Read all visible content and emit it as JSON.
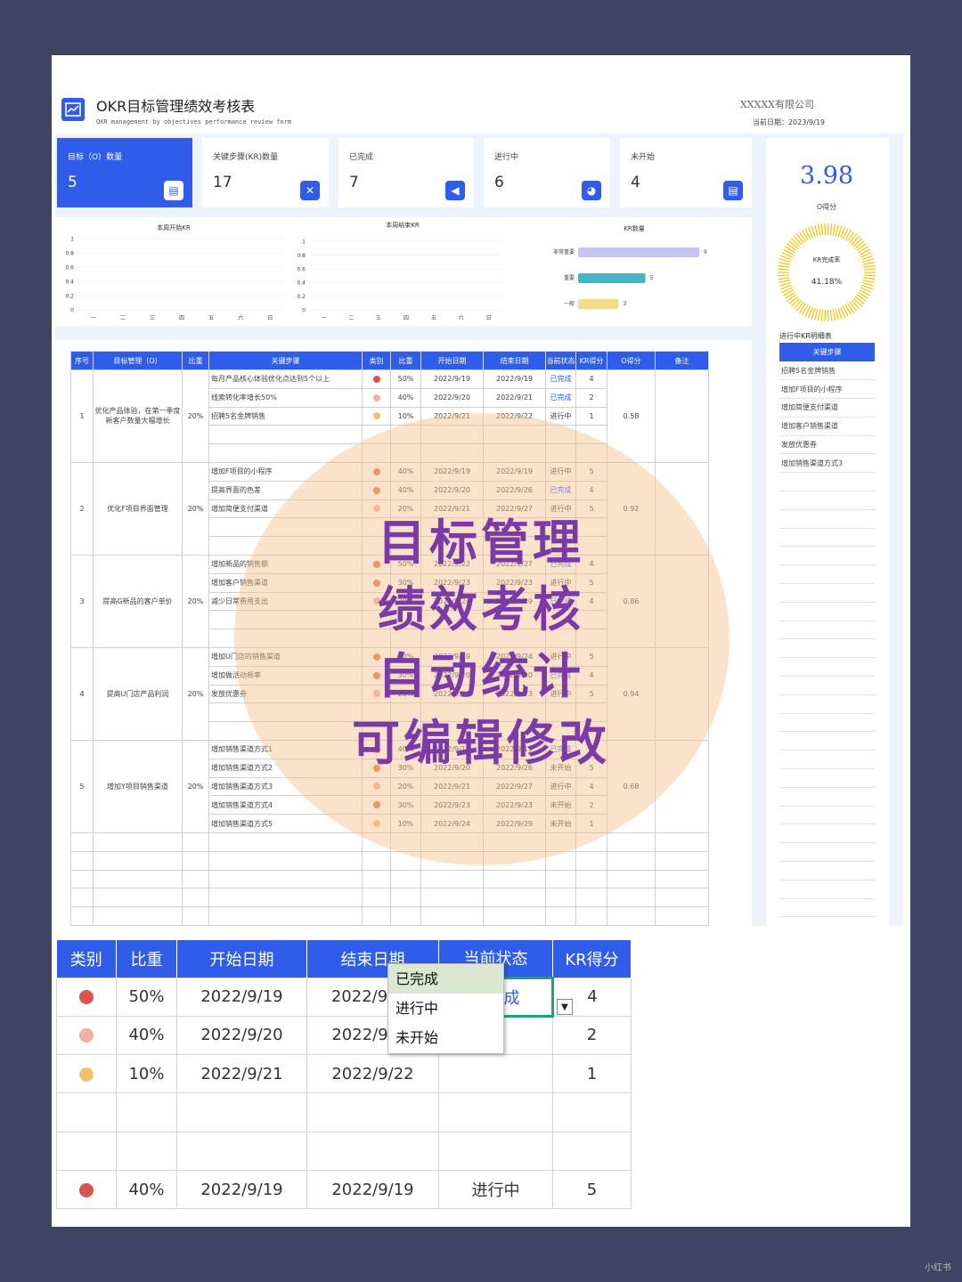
{
  "header": {
    "title": "OKR目标管理绩效考核表",
    "subtitle": "OKR management by objectives performance review form",
    "company": "XXXXX有限公司",
    "date": "当前日期：2023/9/19"
  },
  "cards": [
    {
      "label": "目标（O）数量",
      "value": "5"
    },
    {
      "label": "关键步骤(KR)数量",
      "value": "17"
    },
    {
      "label": "已完成",
      "value": "7"
    },
    {
      "label": "进行中",
      "value": "6"
    },
    {
      "label": "未开始",
      "value": "4"
    }
  ],
  "score": {
    "value": "3.98",
    "label": "O得分",
    "ring_label": "KR完成率",
    "ring_value": "41.18%"
  },
  "chart_data": [
    {
      "type": "line",
      "title": "本周开始KR",
      "categories": [
        "一",
        "二",
        "三",
        "四",
        "五",
        "六",
        "日"
      ],
      "yticks": [
        "1",
        "0.8",
        "0.6",
        "0.4",
        "0.2",
        "0"
      ],
      "ylim": [
        0,
        1
      ]
    },
    {
      "type": "line",
      "title": "本周结束KR",
      "categories": [
        "一",
        "二",
        "三",
        "四",
        "五",
        "六",
        "日"
      ],
      "yticks": [
        "1",
        "0.8",
        "0.6",
        "0.4",
        "0.2",
        "0"
      ],
      "ylim": [
        0,
        1
      ]
    },
    {
      "type": "bar",
      "title": "KR数量",
      "categories": [
        "非常重要",
        "重要",
        "一般"
      ],
      "values": [
        9,
        5,
        3
      ]
    }
  ],
  "table": {
    "headers": [
      "序号",
      "目标管理（O）",
      "比重",
      "关键步骤",
      "类别",
      "比重",
      "开始日期",
      "结束日期",
      "当前状态",
      "KR得分",
      "O得分",
      "备注"
    ],
    "groups": [
      {
        "no": "1",
        "goal": "优化产品体验，在第一季度新客户数量大幅增长",
        "weight": "20%",
        "oscore": "0.58",
        "rows": [
          {
            "kr": "每月产品核心体验优化点达到5个以上",
            "cat": "#d9534f",
            "w": "50%",
            "start": "2022/9/19",
            "end": "2022/9/19",
            "status": "已完成",
            "score": "4"
          },
          {
            "kr": "线索转化率增长50%",
            "cat": "#f2b0a4",
            "w": "40%",
            "start": "2022/9/20",
            "end": "2022/9/21",
            "status": "已完成",
            "score": "2"
          },
          {
            "kr": "招聘5名金牌销售",
            "cat": "#f0c26e",
            "w": "10%",
            "start": "2022/9/21",
            "end": "2022/9/22",
            "status": "进行中",
            "score": "1"
          }
        ]
      },
      {
        "no": "2",
        "goal": "优化F项目界面管理",
        "weight": "20%",
        "oscore": "0.92",
        "rows": [
          {
            "kr": "增加F项目的小程序",
            "cat": "#e8734a",
            "w": "40%",
            "start": "2022/9/19",
            "end": "2022/9/19",
            "status": "进行中",
            "score": "5"
          },
          {
            "kr": "提高界面的色差",
            "cat": "#e8734a",
            "w": "40%",
            "start": "2022/9/20",
            "end": "2022/9/26",
            "status": "已完成",
            "score": "4"
          },
          {
            "kr": "增加简便支付渠道",
            "cat": "#f2b0a4",
            "w": "20%",
            "start": "2022/9/21",
            "end": "2022/9/27",
            "status": "进行中",
            "score": "5"
          }
        ]
      },
      {
        "no": "3",
        "goal": "提高G新品的客户单价",
        "weight": "20%",
        "oscore": "0.86",
        "rows": [
          {
            "kr": "增加新品的销售额",
            "cat": "#e8734a",
            "w": "50%",
            "start": "2022/9/22",
            "end": "2022/9/27",
            "status": "已完成",
            "score": "4"
          },
          {
            "kr": "增加客户销售渠道",
            "cat": "#e8734a",
            "w": "30%",
            "start": "2022/9/23",
            "end": "2022/9/23",
            "status": "进行中",
            "score": "5"
          },
          {
            "kr": "减少日常费用支出",
            "cat": "#f2b0a4",
            "w": "20%",
            "start": "2022/9/24",
            "end": "2022/9/29",
            "status": "已完成",
            "score": "4"
          }
        ]
      },
      {
        "no": "4",
        "goal": "提高U门店产品利润",
        "weight": "20%",
        "oscore": "0.94",
        "rows": [
          {
            "kr": "增加U门店的销售渠道",
            "cat": "#e8734a",
            "w": "50%",
            "start": "2022/9/19",
            "end": "2022/9/24",
            "status": "进行中",
            "score": "5"
          },
          {
            "kr": "增加做活动频率",
            "cat": "#e8734a",
            "w": "30%",
            "start": "2022/9/20",
            "end": "2022/9/20",
            "status": "已完成",
            "score": "4"
          },
          {
            "kr": "发放优惠券",
            "cat": "#f2b0a4",
            "w": "20%",
            "start": "2022/9/23",
            "end": "2022/9/23",
            "status": "进行中",
            "score": "5"
          }
        ]
      },
      {
        "no": "5",
        "goal": "增加Y项目销售渠道",
        "weight": "20%",
        "oscore": "0.68",
        "rows": [
          {
            "kr": "增加销售渠道方式1",
            "cat": "#e8734a",
            "w": "40%",
            "start": "2022/9/19",
            "end": "2022/9/19",
            "status": "已完成",
            "score": "4"
          },
          {
            "kr": "增加销售渠道方式2",
            "cat": "#e8734a",
            "w": "30%",
            "start": "2022/9/20",
            "end": "2022/9/26",
            "status": "未开始",
            "score": "5"
          },
          {
            "kr": "增加销售渠道方式3",
            "cat": "#f2b0a4",
            "w": "20%",
            "start": "2022/9/21",
            "end": "2022/9/27",
            "status": "进行中",
            "score": "4"
          },
          {
            "kr": "增加销售渠道方式4",
            "cat": "#e8734a",
            "w": "30%",
            "start": "2022/9/23",
            "end": "2022/9/23",
            "status": "未开始",
            "score": "2"
          },
          {
            "kr": "增加销售渠道方式5",
            "cat": "#f0c26e",
            "w": "10%",
            "start": "2022/9/24",
            "end": "2022/9/29",
            "status": "未开始",
            "score": "1"
          }
        ]
      }
    ]
  },
  "side_table": {
    "caption": "进行中KR明细表",
    "header": "关键步骤",
    "items": [
      "招聘5名金牌销售",
      "增加F项目的小程序",
      "增加简便支付渠道",
      "增加客户销售渠道",
      "发放优惠券",
      "增加销售渠道方式3"
    ]
  },
  "zoom": {
    "headers": [
      "类别",
      "比重",
      "开始日期",
      "结束日期",
      "当前状态",
      "KR得分"
    ],
    "rows": [
      {
        "cat": "#d9534f",
        "w": "50%",
        "start": "2022/9/19",
        "end": "2022/9/19",
        "status": "已完成",
        "score": "4"
      },
      {
        "cat": "#f2b0a4",
        "w": "40%",
        "start": "2022/9/20",
        "end": "2022/9/21",
        "status": "",
        "score": "2"
      },
      {
        "cat": "#f0c26e",
        "w": "10%",
        "start": "2022/9/21",
        "end": "2022/9/22",
        "status": "",
        "score": "1"
      },
      {
        "cat": "",
        "w": "",
        "start": "",
        "end": "",
        "status": "",
        "score": ""
      },
      {
        "cat": "",
        "w": "",
        "start": "",
        "end": "",
        "status": "",
        "score": ""
      },
      {
        "cat": "#d9534f",
        "w": "40%",
        "start": "2022/9/19",
        "end": "2022/9/19",
        "status": "进行中",
        "score": "5"
      }
    ],
    "dropdown_options": [
      "已完成",
      "进行中",
      "未开始"
    ]
  },
  "overlay_lines": [
    "目标管理",
    "绩效考核",
    "自动统计",
    "可编辑修改"
  ],
  "watermark": "小红书",
  "colors": {
    "accent": "#2f5ce8",
    "bg": "#3d4562",
    "overlay_text": "#7b3aa8"
  }
}
